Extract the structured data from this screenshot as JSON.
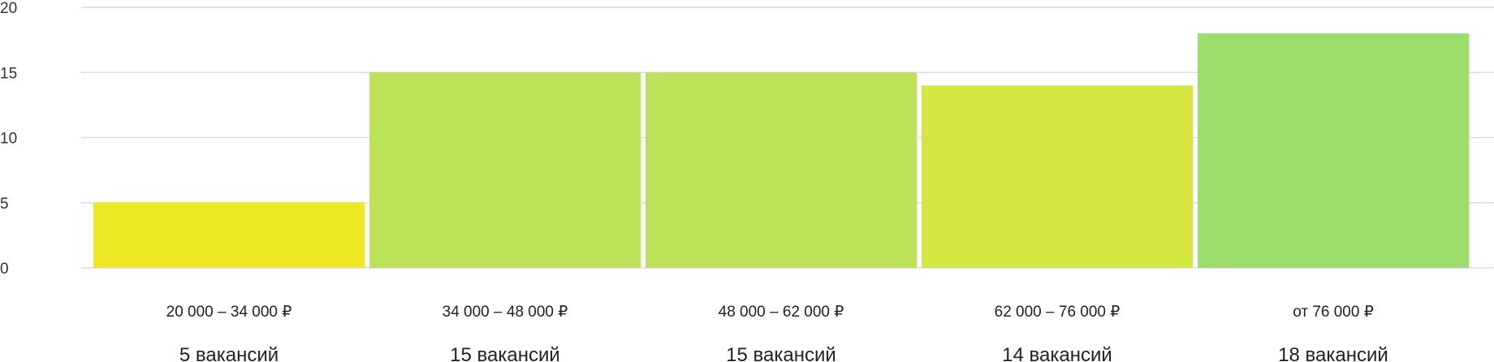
{
  "chart_data": {
    "type": "bar",
    "categories": [
      "20 000 – 34 000 ₽",
      "34 000 – 48 000 ₽",
      "48 000 – 62 000 ₽",
      "62 000 – 76 000 ₽",
      "от 76 000 ₽"
    ],
    "values": [
      5,
      15,
      15,
      14,
      18
    ],
    "counts": [
      "5 вакансий",
      "15 вакансий",
      "15 вакансий",
      "14 вакансий",
      "18 вакансий"
    ],
    "colors": [
      "#efe825",
      "#bbe258",
      "#bbe258",
      "#d6e640",
      "#9cdd6c"
    ],
    "ylim": [
      0,
      20
    ],
    "yticks": [
      "0",
      "5",
      "10",
      "15",
      "20"
    ],
    "grid": true,
    "title": "",
    "xlabel": "",
    "ylabel": ""
  }
}
